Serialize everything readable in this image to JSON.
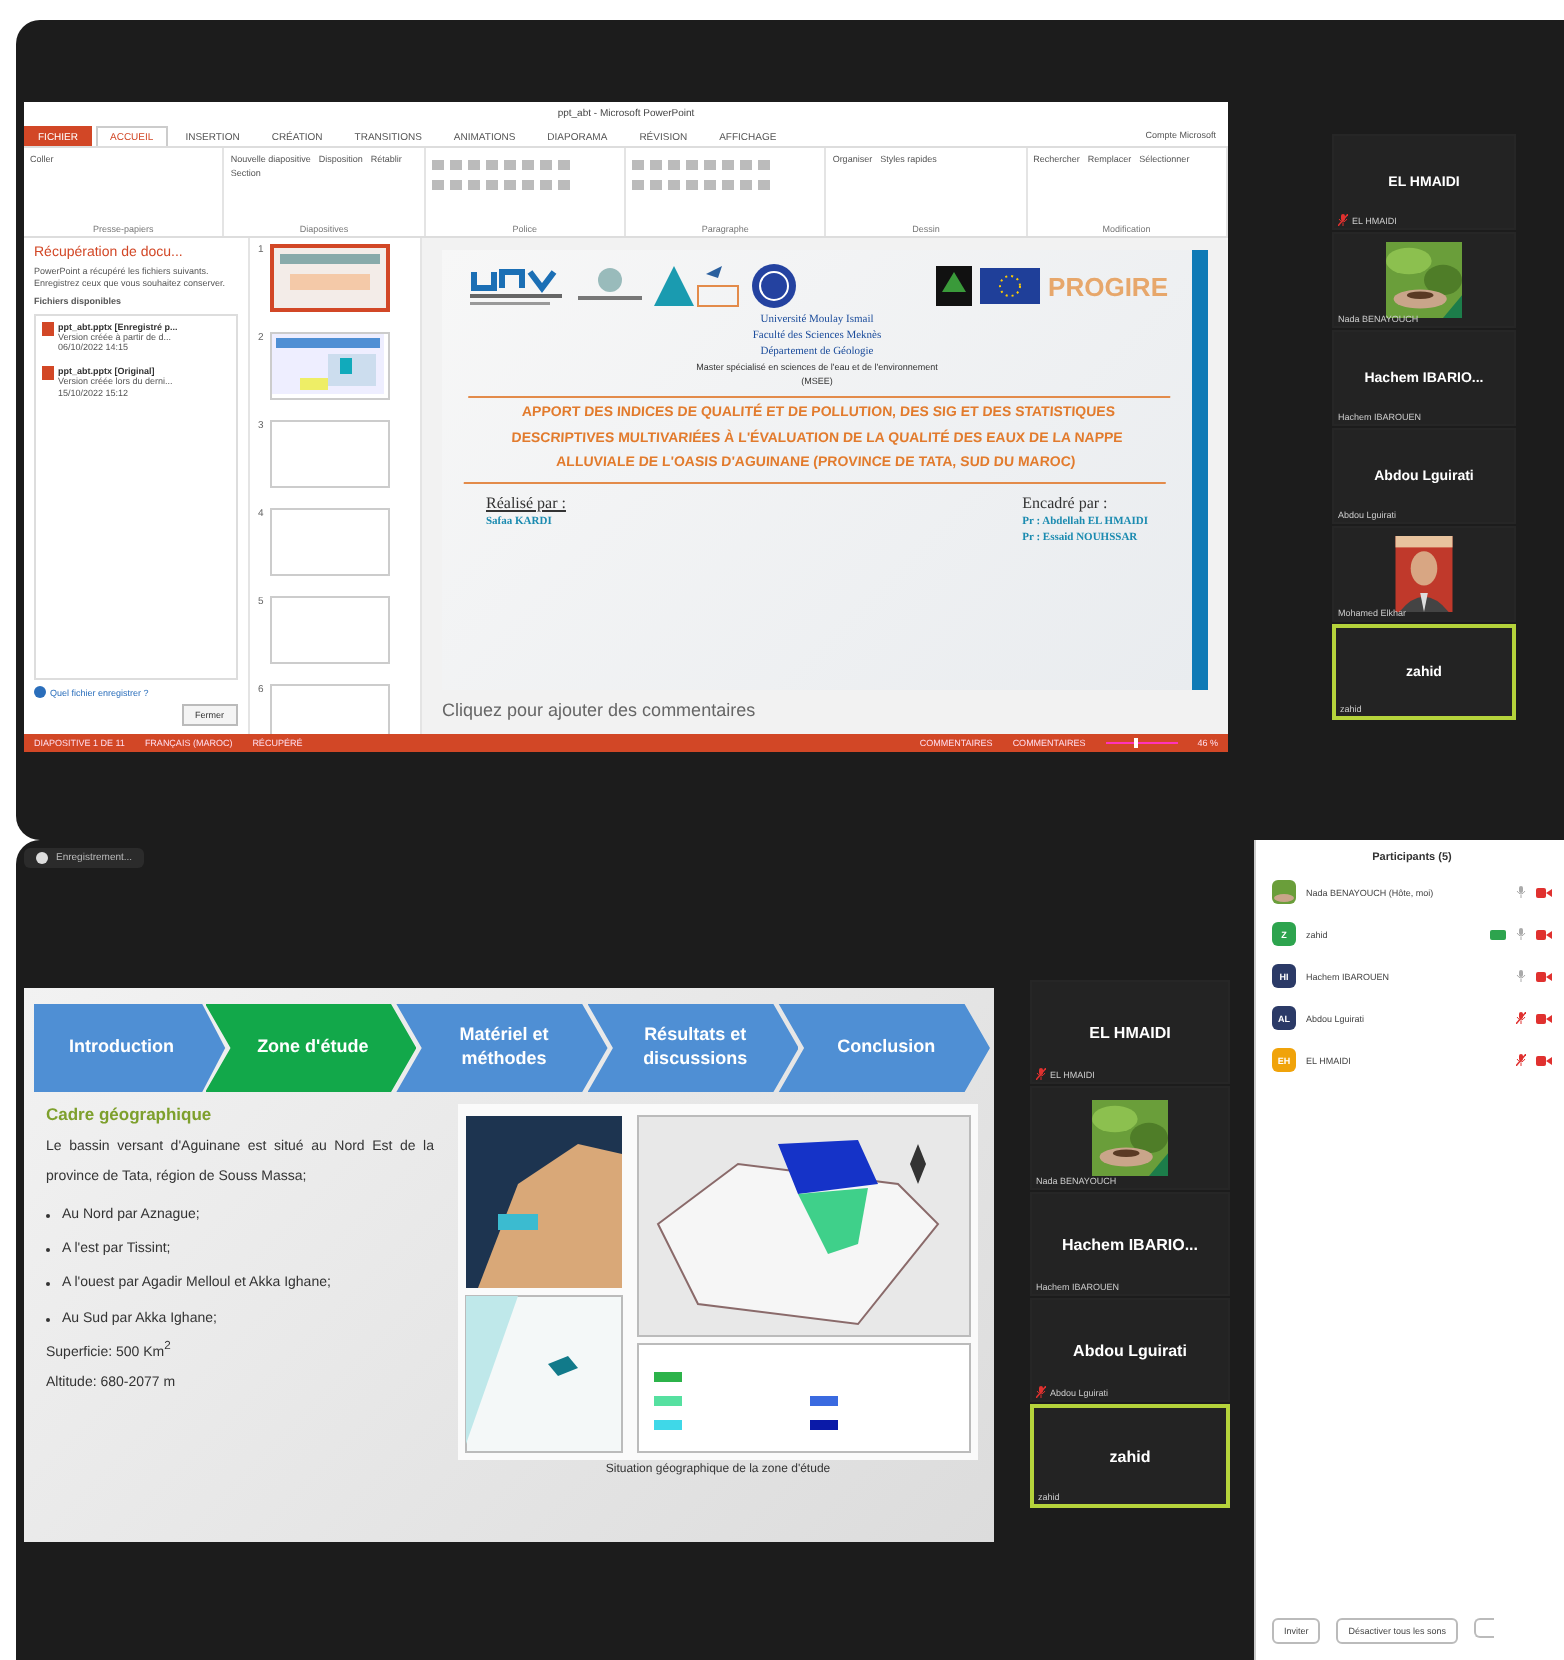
{
  "top_screen": {
    "powerpoint": {
      "title": "ppt_abt - Microsoft PowerPoint",
      "account": "Compte Microsoft",
      "ribbon_tabs": [
        {
          "label": "FICHIER",
          "kind": "file",
          "selected": false
        },
        {
          "label": "ACCUEIL",
          "kind": "tab",
          "selected": true
        },
        {
          "label": "INSERTION",
          "kind": "tab",
          "selected": false
        },
        {
          "label": "CRÉATION",
          "kind": "tab",
          "selected": false
        },
        {
          "label": "TRANSITIONS",
          "kind": "tab",
          "selected": false
        },
        {
          "label": "ANIMATIONS",
          "kind": "tab",
          "selected": false
        },
        {
          "label": "DIAPORAMA",
          "kind": "tab",
          "selected": false
        },
        {
          "label": "RÉVISION",
          "kind": "tab",
          "selected": false
        },
        {
          "label": "AFFICHAGE",
          "kind": "tab",
          "selected": false
        }
      ],
      "ribbon_groups": [
        {
          "label": "Presse-papiers",
          "buttons": [
            "Coller"
          ]
        },
        {
          "label": "Diapositives",
          "buttons": [
            "Nouvelle diapositive",
            "Disposition",
            "Rétablir",
            "Section"
          ]
        },
        {
          "label": "Police"
        },
        {
          "label": "Paragraphe"
        },
        {
          "label": "Dessin",
          "buttons": [
            "Organiser",
            "Styles rapides"
          ]
        },
        {
          "label": "Modification",
          "buttons": [
            "Rechercher",
            "Remplacer",
            "Sélectionner"
          ]
        }
      ],
      "recovery": {
        "title": "Récupération de docu...",
        "description": "PowerPoint a récupéré les fichiers suivants. Enregistrez ceux que vous souhaitez conserver.",
        "heading": "Fichiers disponibles",
        "files": [
          {
            "name": "ppt_abt.pptx [Enregistré p...",
            "detail": "Version créée à partir de d...",
            "date": "06/10/2022 14:15"
          },
          {
            "name": "ppt_abt.pptx [Original]",
            "detail": "Version créée lors du derni...",
            "date": "15/10/2022 15:12"
          }
        ],
        "link": "Quel fichier enregistrer ?",
        "close": "Fermer"
      },
      "thumbnails": [
        {
          "number": "1",
          "selected": true,
          "kind": "title"
        },
        {
          "number": "2",
          "selected": false,
          "kind": "map"
        },
        {
          "number": "3",
          "selected": false,
          "kind": "blank"
        },
        {
          "number": "4",
          "selected": false,
          "kind": "blank"
        },
        {
          "number": "5",
          "selected": false,
          "kind": "blank"
        },
        {
          "number": "6",
          "selected": false,
          "kind": "blank"
        }
      ],
      "slide": {
        "partner_logo": "PROGIRE",
        "institution": [
          "Université Moulay Ismail",
          "Faculté des Sciences Meknès",
          "Département de Géologie"
        ],
        "master": "Master spécialisé en sciences de l'eau et de l'environnement",
        "master_code": "(MSEE)",
        "title": "APPORT DES INDICES DE QUALITÉ ET DE POLLUTION, DES SIG ET DES STATISTIQUES DESCRIPTIVES MULTIVARIÉES À L'ÉVALUATION DE LA QUALITÉ DES EAUX DE LA NAPPE ALLUVIALE DE L'OASIS D'AGUINANE (PROVINCE DE TATA, SUD DU MAROC)",
        "author_label": "Réalisé par :",
        "author": "Safaa KARDI",
        "supervisor_label": "Encadré par :",
        "supervisors": [
          "Pr : Abdellah EL HMAIDI",
          "Pr : Essaid NOUHSSAR"
        ]
      },
      "notes_placeholder": "Cliquez pour ajouter des commentaires",
      "status": {
        "slide": "DIAPOSITIVE 1 DE 11",
        "language": "FRANÇAIS (MAROC)",
        "state": "RÉCUPÉRÉ",
        "notes": "COMMENTAIRES",
        "comments": "COMMENTAIRES",
        "zoom": "46 %",
        "level": 0.4
      }
    },
    "videos": [
      {
        "kind": "name",
        "name": "EL HMAIDI",
        "label": "EL HMAIDI",
        "muted": true,
        "speaking": false
      },
      {
        "kind": "picture",
        "label": "Nada BENAYOUCH",
        "muted": false,
        "speaking": false
      },
      {
        "kind": "name",
        "name": "Hachem IBARIO...",
        "label": "Hachem IBAROUEN",
        "muted": false,
        "speaking": false
      },
      {
        "kind": "name",
        "name": "Abdou Lguirati",
        "label": "Abdou Lguirati",
        "muted": false,
        "speaking": false
      },
      {
        "kind": "person",
        "label": "Mohamed Elkhar",
        "muted": false,
        "speaking": false
      },
      {
        "kind": "name",
        "name": "zahid",
        "label": "zahid",
        "muted": false,
        "speaking": true
      }
    ]
  },
  "bottom_screen": {
    "recording": "Enregistrement...",
    "slide": {
      "steps": [
        {
          "label": "Introduction",
          "selected": false
        },
        {
          "label": "Zone d'étude",
          "selected": true
        },
        {
          "label": "Matériel et méthodes",
          "selected": false
        },
        {
          "label": "Résultats et discussions",
          "selected": false
        },
        {
          "label": "Conclusion",
          "selected": false
        }
      ],
      "heading": "Cadre géographique",
      "paragraph": "Le bassin versant d'Aguinane est situé au Nord Est de la province de Tata, région de Souss Massa;",
      "bullets": [
        "Au Nord par Aznague;",
        "A l'est par Tissint;",
        "A l'ouest par Agadir Melloul et Akka Ighane;",
        "Au Sud par Akka Ighane;"
      ],
      "facts": [
        "Superficie: 500 Km$^{2}$",
        "Altitude: 680-2077 m"
      ],
      "caption": "Situation géographique de la zone d'étude"
    },
    "videos": [
      {
        "kind": "name",
        "name": "EL HMAIDI",
        "label": "EL HMAIDI",
        "muted": true,
        "speaking": false
      },
      {
        "kind": "picture",
        "label": "Nada BENAYOUCH",
        "muted": false,
        "speaking": false
      },
      {
        "kind": "name",
        "name": "Hachem IBARIO...",
        "label": "Hachem IBAROUEN",
        "muted": false,
        "speaking": false
      },
      {
        "kind": "name",
        "name": "Abdou Lguirati",
        "label": "Abdou Lguirati",
        "muted": true,
        "speaking": false
      },
      {
        "kind": "name",
        "name": "zahid",
        "label": "zahid",
        "muted": false,
        "speaking": true
      }
    ],
    "participants": {
      "title": "Participants (5)",
      "people": [
        {
          "name": "Nada BENAYOUCH (Hôte, moi)",
          "kind": "picture",
          "muted": false,
          "video_on": false
        },
        {
          "name": "zahid",
          "kind": "initials",
          "initials": "Z",
          "color": "#2da44e",
          "muted": false,
          "video_on": false,
          "sharing": true
        },
        {
          "name": "Hachem IBAROUEN",
          "kind": "initials",
          "initials": "HI",
          "color": "#2b3a67",
          "muted": false,
          "video_on": false
        },
        {
          "name": "Abdou Lguirati",
          "kind": "initials",
          "initials": "AL",
          "color": "#2b3a67",
          "muted": true,
          "video_on": false
        },
        {
          "name": "EL HMAIDI",
          "kind": "initials",
          "initials": "EH",
          "color": "#f0a30a",
          "muted": true,
          "video_on": false
        }
      ],
      "buttons": [
        "Inviter",
        "Désactiver tous les sons"
      ]
    }
  }
}
